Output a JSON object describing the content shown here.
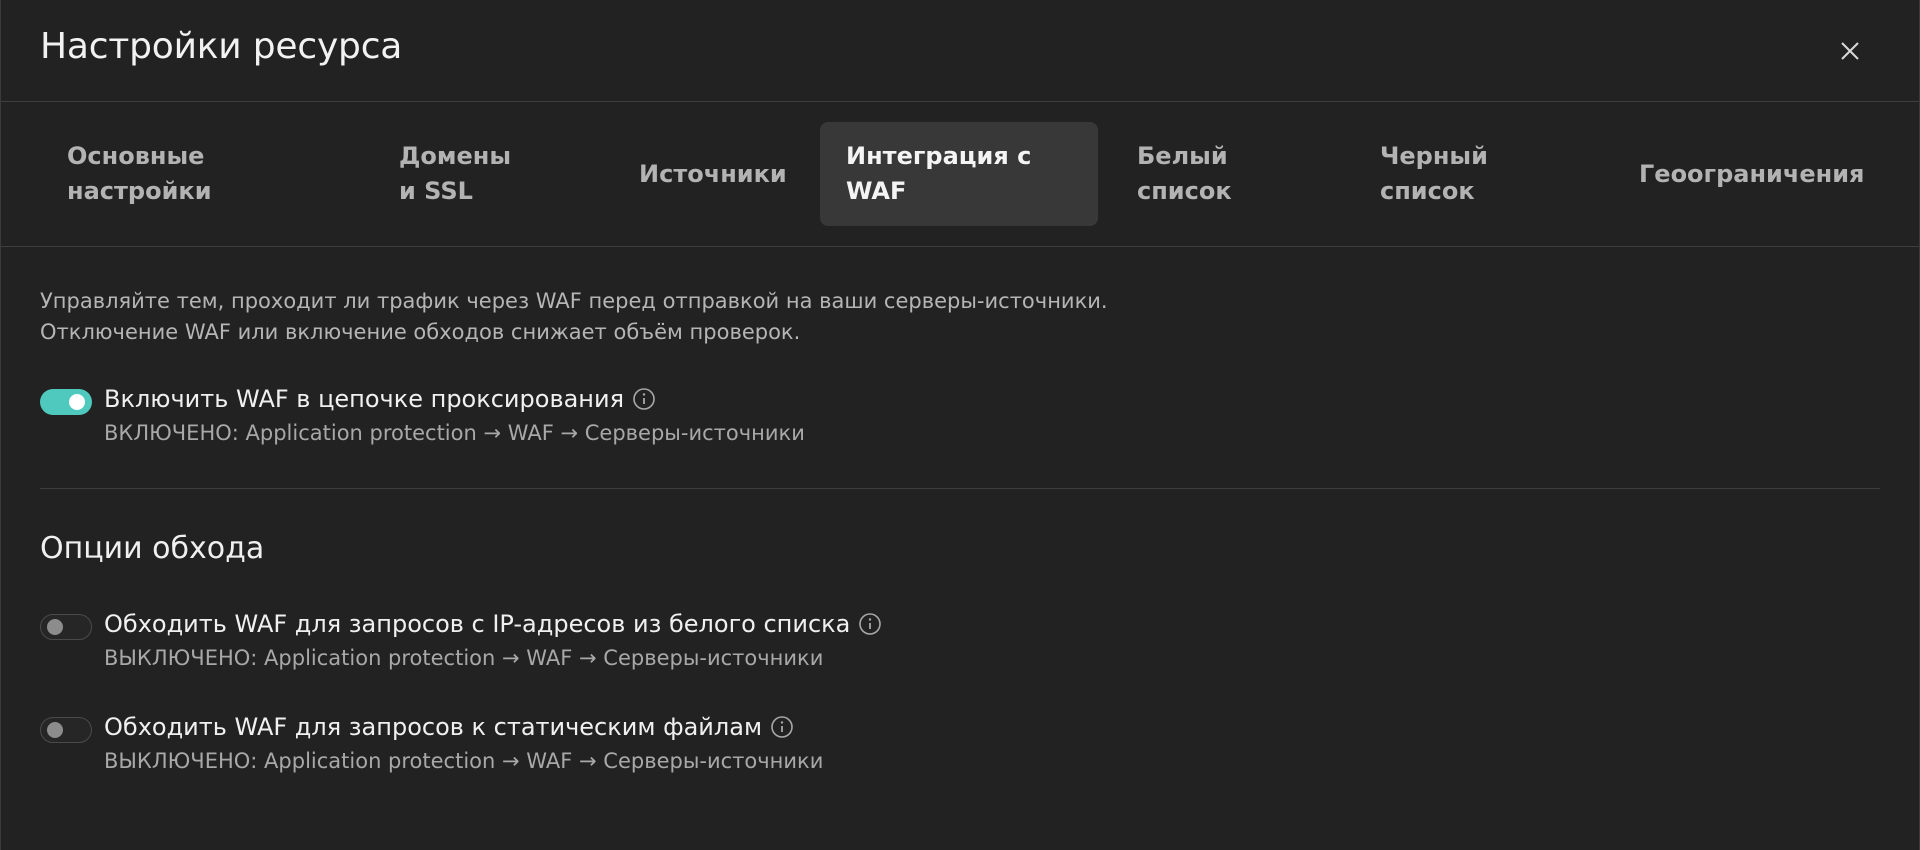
{
  "header": {
    "title": "Настройки ресурса",
    "close_icon": "close-icon"
  },
  "tabs": [
    {
      "label": "Основные настройки",
      "active": false
    },
    {
      "label": "Домены и SSL",
      "active": false
    },
    {
      "label": "Источники",
      "active": false
    },
    {
      "label": "Интеграция с WAF",
      "active": true
    },
    {
      "label": "Белый список",
      "active": false
    },
    {
      "label": "Черный список",
      "active": false
    },
    {
      "label": "Геоограничения",
      "active": false
    }
  ],
  "main": {
    "description_line1": "Управляйте тем, проходит ли трафик через WAF перед отправкой на ваши серверы-источники.",
    "description_line2": "Отключение WAF или включение обходов снижает объём проверок.",
    "waf_toggle": {
      "label": "Включить WAF в цепочке проксирования",
      "status": "ВКЛЮЧЕНО: Application protection → WAF → Серверы-источники",
      "enabled": true
    },
    "bypass_section_title": "Опции обхода",
    "bypass_options": [
      {
        "label": "Обходить WAF для запросов с IP-адресов из белого списка",
        "status": "ВЫКЛЮЧЕНО: Application protection → WAF → Серверы-источники",
        "enabled": false
      },
      {
        "label": "Обходить WAF для запросов к статическим файлам",
        "status": "ВЫКЛЮЧЕНО: Application protection → WAF → Серверы-источники",
        "enabled": false
      }
    ]
  },
  "colors": {
    "background": "#222222",
    "accent_toggle_on": "#4fc9bd",
    "active_tab_bg": "#383838"
  }
}
